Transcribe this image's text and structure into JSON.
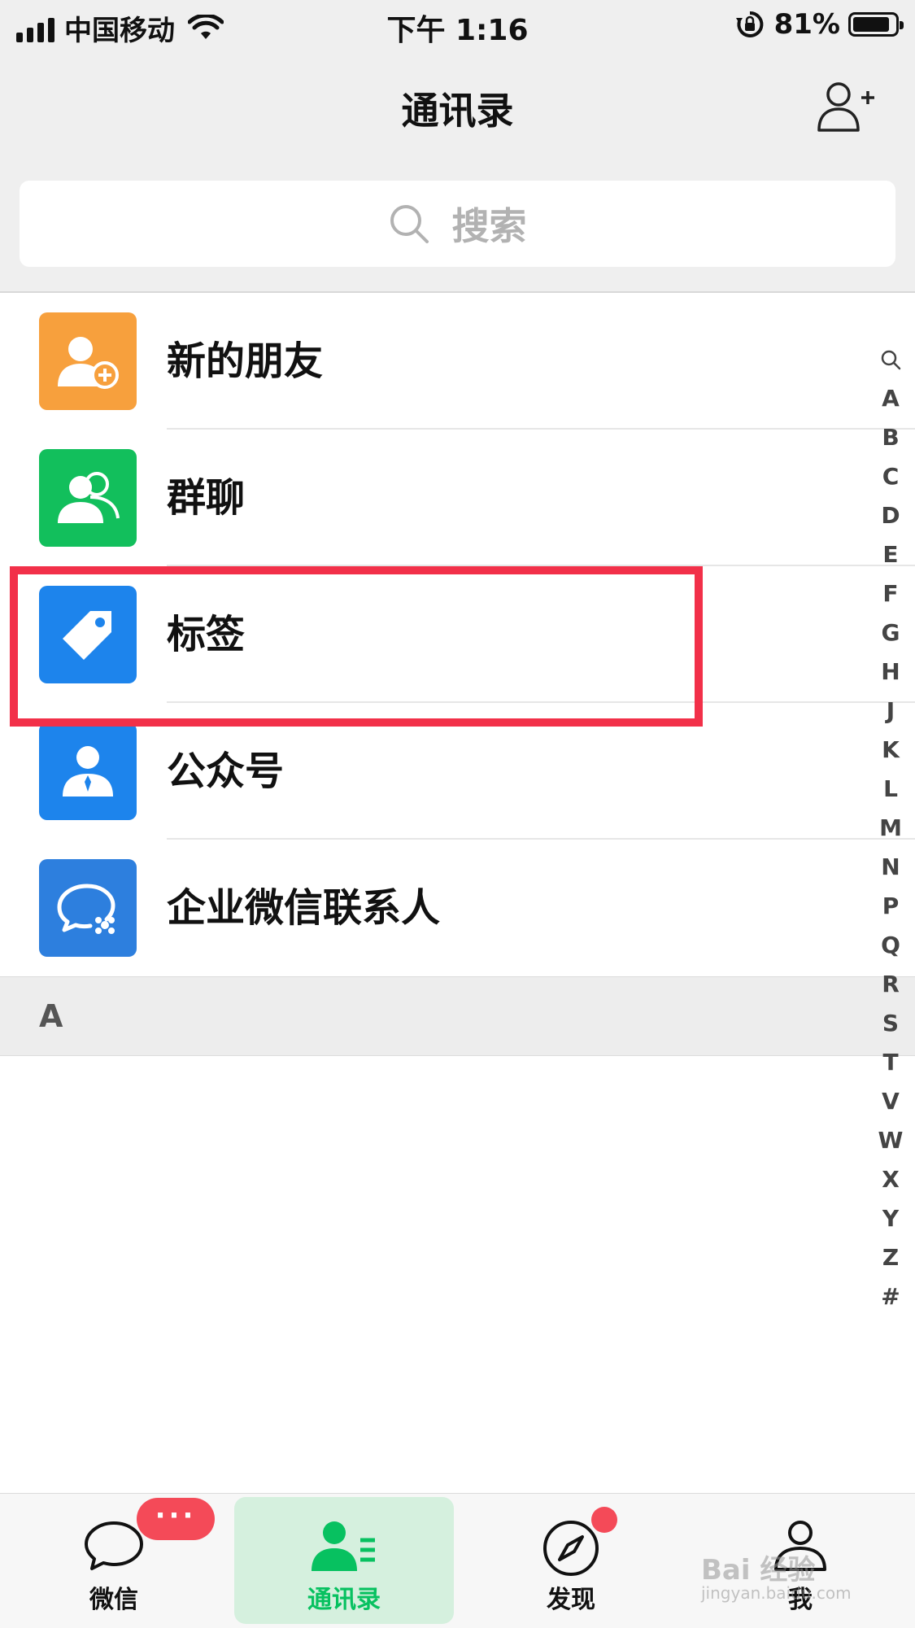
{
  "status_bar": {
    "carrier": "中国移动",
    "time": "下午 1:16",
    "battery_percent": "81%"
  },
  "nav": {
    "title": "通讯录"
  },
  "search": {
    "placeholder": "搜索"
  },
  "function_items": [
    {
      "label": "新的朋友",
      "icon": "add-friend-icon",
      "color": "#f7a03d"
    },
    {
      "label": "群聊",
      "icon": "group-chat-icon",
      "color": "#12bf5c"
    },
    {
      "label": "标签",
      "icon": "tag-icon",
      "color": "#1d84ec"
    },
    {
      "label": "公众号",
      "icon": "official-account-icon",
      "color": "#1d84ec"
    },
    {
      "label": "企业微信联系人",
      "icon": "wecom-contact-icon",
      "color": "#2d7fde"
    }
  ],
  "section": {
    "letter": "A"
  },
  "index_letters": [
    "A",
    "B",
    "C",
    "D",
    "E",
    "F",
    "G",
    "H",
    "J",
    "K",
    "L",
    "M",
    "N",
    "P",
    "Q",
    "R",
    "S",
    "T",
    "V",
    "W",
    "X",
    "Y",
    "Z",
    "#"
  ],
  "tabs": [
    {
      "label": "微信",
      "active": false
    },
    {
      "label": "通讯录",
      "active": true
    },
    {
      "label": "发现",
      "active": false
    },
    {
      "label": "我",
      "active": false
    }
  ],
  "badges": {
    "wechat_tab": "···"
  },
  "watermark": {
    "text": "Bai 经验",
    "sub": "jingyan.baidu.com"
  },
  "colors": {
    "accent": "#07c160",
    "highlight": "#f23049",
    "badge": "#f44a58"
  }
}
